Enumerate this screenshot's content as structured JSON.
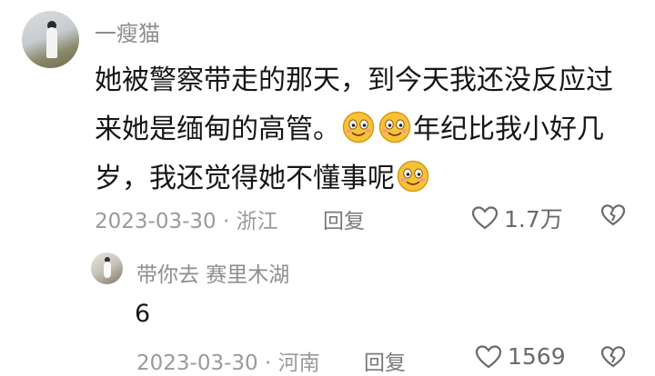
{
  "comment": {
    "username": "一瘦猫",
    "text_part1": "她被警察带走的那天，到今天我还没反应过来她是缅甸的高管。",
    "text_part2": "年纪比我小好几岁，我还觉得她不懂事呢",
    "date_location": "2023-03-30 · 浙江",
    "reply_label": "回复",
    "likes": "1.7万"
  },
  "reply": {
    "username": "带你去 赛里木湖",
    "text": "6",
    "date_location": "2023-03-30 · 河南",
    "reply_label": "回复",
    "likes": "1569"
  },
  "icons": [
    "heart-icon",
    "broken-heart-icon",
    "smiling-emoji-icon"
  ],
  "colors": {
    "meta": "#9a9a9a",
    "text": "#161616",
    "emoji": "#f7c23a"
  }
}
